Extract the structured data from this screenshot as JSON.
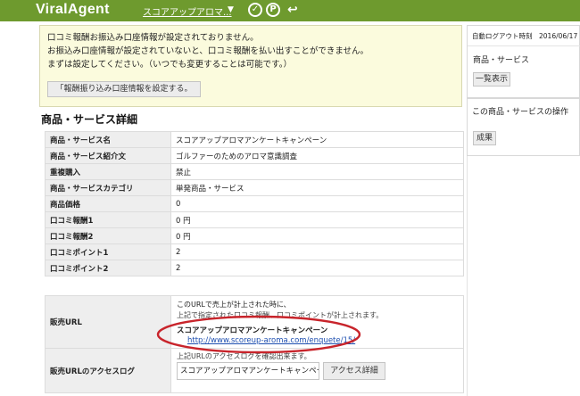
{
  "header": {
    "brand": "ViralAgent",
    "campaign_link": "スコアアップアロマ...",
    "caret": "▼",
    "check_glyph": "✓",
    "p_glyph": "P",
    "return_glyph": "↩",
    "icons": [
      "chevron-down-icon",
      "check-circle-icon",
      "p-circle-icon",
      "return-arrow-icon"
    ]
  },
  "notice": {
    "lines": [
      "口コミ報酬お振込み口座情報が設定されておりません。",
      "お振込み口座情報が設定されていないと、口コミ報酬を払い出すことができません。",
      "まずは設定してください。（いつでも変更することは可能です。）"
    ],
    "button": "「報酬振り込み口座情報を設定する。"
  },
  "section_title": "商品・サービス詳細",
  "details": [
    {
      "label": "商品・サービス名",
      "value": "スコアアップアロマアンケートキャンペーン"
    },
    {
      "label": "商品・サービス紹介文",
      "value": "ゴルファーのためのアロマ意識調査"
    },
    {
      "label": "重複購入",
      "value": "禁止"
    },
    {
      "label": "商品・サービスカテゴリ",
      "value": "単発商品・サービス"
    },
    {
      "label": "商品価格",
      "value": "0"
    },
    {
      "label": "口コミ報酬1",
      "value": "0 円"
    },
    {
      "label": "口コミ報酬2",
      "value": "0 円"
    },
    {
      "label": "口コミポイント1",
      "value": "2"
    },
    {
      "label": "口コミポイント2",
      "value": "2"
    }
  ],
  "sales_url": {
    "label": "販売URL",
    "desc1": "このURLで売上が計上された時に、",
    "desc2": "上記で指定された口コミ報酬、口コミポイントが計上されます。",
    "campaign_name": "スコアアップアロマアンケートキャンペーン",
    "url": "http://www.scoreup-aroma.com/enquete/15/"
  },
  "access_log": {
    "label": "販売URLのアクセスログ",
    "desc": "上記URLのアクセスログを確認出来ます。",
    "field_value": "スコアアップアロマアンケートキャンペーン",
    "button": "アクセス詳細"
  },
  "sidebar": {
    "logout_label": "自動ログアウト時刻",
    "logout_time": "2016/06/17",
    "section1_title": "商品・サービス",
    "section1_button": "一覧表示",
    "section2_title": "この商品・サービスの操作",
    "section2_button": "成果"
  },
  "colors": {
    "header_green": "#6e9a2e",
    "notice_bg": "#fbfbdd",
    "annotation_red": "#c8242b",
    "link_blue": "#1e4fb0"
  }
}
